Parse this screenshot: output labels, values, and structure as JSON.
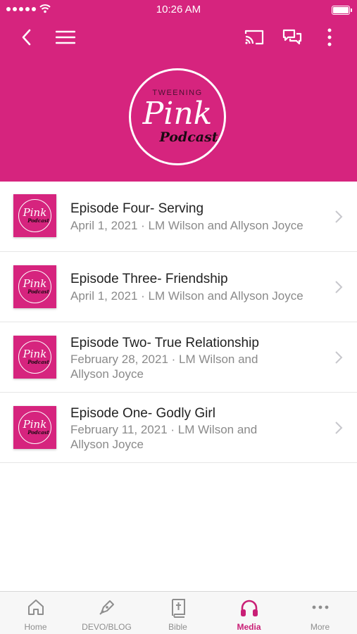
{
  "status_bar": {
    "time": "10:26 AM"
  },
  "header": {
    "logo": {
      "top_text": "TWEENING",
      "main_text": "Pink",
      "sub_text": "Podcast"
    },
    "background_color": "#d6247e",
    "icons": [
      "back-icon",
      "menu-icon",
      "cast-icon",
      "chat-icon",
      "more-vertical-icon"
    ]
  },
  "episodes": [
    {
      "title": "Episode Four- Serving",
      "meta_line1": "April 1, 2021 · LM Wilson and Allyson Joyce",
      "meta_line2": ""
    },
    {
      "title": "Episode Three- Friendship",
      "meta_line1": "April 1, 2021 · LM Wilson and Allyson Joyce",
      "meta_line2": ""
    },
    {
      "title": "Episode Two- True Relationship",
      "meta_line1": "February 28, 2021 · LM Wilson and",
      "meta_line2": "Allyson Joyce"
    },
    {
      "title": "Episode One- Godly Girl",
      "meta_line1": "February 11, 2021 · LM Wilson and",
      "meta_line2": "Allyson Joyce"
    }
  ],
  "thumb": {
    "main_text": "Pink",
    "sub_text": "Podcast"
  },
  "tabbar": {
    "tabs": [
      {
        "label": "Home",
        "icon": "home-icon",
        "active": false
      },
      {
        "label": "DEVO/BLOG",
        "icon": "pen-icon",
        "active": false
      },
      {
        "label": "Bible",
        "icon": "bible-icon",
        "active": false
      },
      {
        "label": "Media",
        "icon": "headphones-icon",
        "active": true
      },
      {
        "label": "More",
        "icon": "more-horizontal-icon",
        "active": false
      }
    ],
    "active_color": "#c91f76",
    "inactive_color": "#8e8e8e"
  }
}
